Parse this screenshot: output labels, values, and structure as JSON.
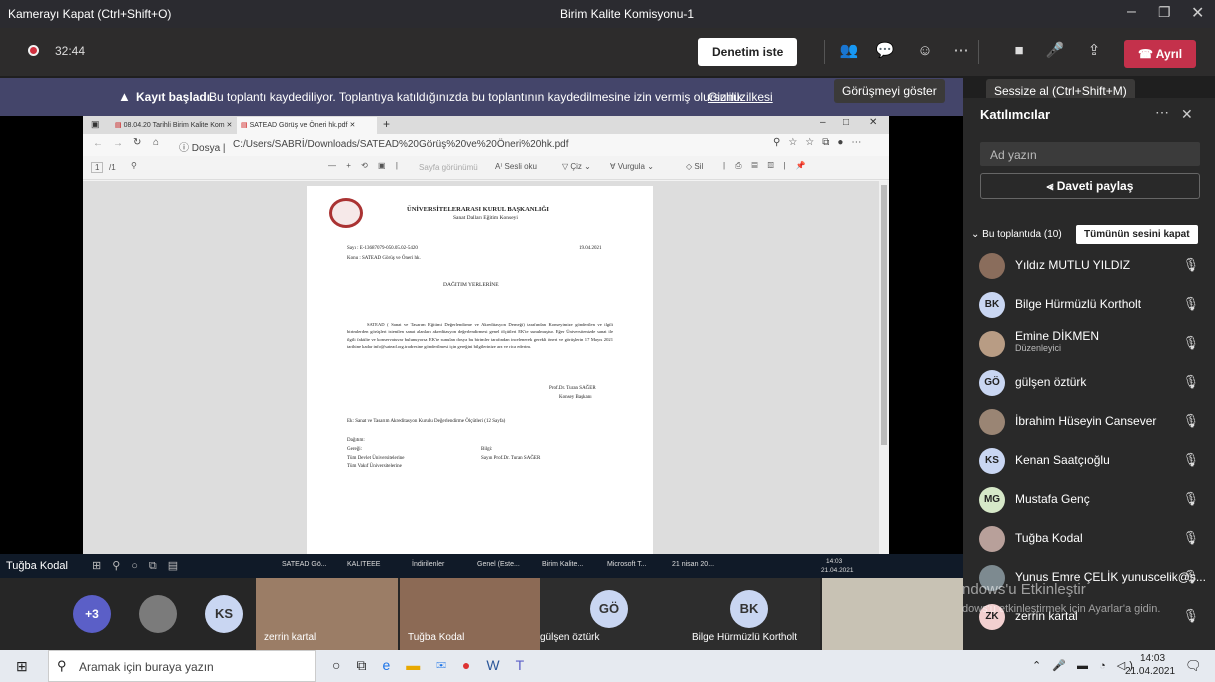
{
  "window": {
    "camera_toggle": "Kamerayı Kapat (Ctrl+Shift+O)",
    "title": "Birim Kalite Komisyonu-1"
  },
  "toolbar": {
    "timer": "32:44",
    "raise_label": "Denetim iste",
    "leave_label": "Ayrıl",
    "tooltip_chat": "Görüşmeyi göster",
    "tooltip_mute": "Sessize al (Ctrl+Shift+M)"
  },
  "banner": {
    "bold": "Kayıt başladı.",
    "text": "Bu toplantı kaydediliyor. Toplantıya katıldığınızda bu toplantının kaydedilmesine izin vermiş olursunuz.",
    "link": "Gizlilik ilkesi"
  },
  "browser": {
    "tab1": "08.04.20 Tarihli Birim Kalite Kom",
    "tab2": "SATEAD Görüş ve Öneri hk.pdf",
    "url_prefix": "Dosya",
    "url": "C:/Users/SABRİ/Downloads/SATEAD%20Görüş%20ve%20Öneri%20hk.pdf",
    "page": "1",
    "page_total": "/1",
    "tb_sayfa": "Sayfa görünümü",
    "tb_sesli": "Sesli oku",
    "tb_ciz": "Çiz",
    "tb_vurgula": "Vurgula",
    "tb_sil": "Sil"
  },
  "doc": {
    "org": "ÜNİVERSİTELERARASI KURUL BAŞKANLIĞI",
    "sub": "Sanat Dalları Eğitim Konseyi",
    "sayi": "Sayı    : E-13687079-050.05.02-5420",
    "date": "19.04.2021",
    "konu": "Konu    : SATEAD Görüş ve Öneri hk.",
    "heading": "DAĞITIM YERLERİNE",
    "body": "SATEAD ( Sanat ve Tasarım Eğitimi Değerlendirme ve Akreditasyon Derneği) tarafından Konseyimize gönderilen ve ilgili birimlerden görüşleri istenilen sanat alanları akreditasyon değerlendirmesi genel ölçütleri EK'te sunulmuştur. Eğer Üniversitenizde sanat ile ilgili fakülte ve konservatuvar bulunuyorsa EK'te sunulan dosya bu birimler tarafından incelenerek gerekli öneri ve görüşlerin 17 Mayıs 2021 tarihine kadar info@satead.org.tradresine gönderilmesi için gereğini bilgilerinize arz ve rica ederim.",
    "sign_name": "Prof.Dr. Turan SAĞER",
    "sign_title": "Konsey Başkanı",
    "ek": "Ek:   Sanat ve Tasarım Akreditasyon Kurulu Değerlendirme Ölçütleri (12 Sayfa)",
    "dagitim": "Dağıtım:",
    "geregi": "Gereği:",
    "bilgi": "Bilgi:",
    "d1": "Tüm Devlet Üniversitelerine",
    "d2": "Tüm Vakıf Üniversitelerine",
    "b1": "Sayın Prof.Dr. Turan SAĞER"
  },
  "shared_taskbar": {
    "presenter": "Tuğba Kodal",
    "apps": [
      "SATEAD Gö...",
      "KALITEEE",
      "İndirilenler",
      "Genel (Este...",
      "Birim Kalite...",
      "Microsoft T...",
      "21 nisan 20..."
    ],
    "time": "14:03",
    "date": "21.04.2021"
  },
  "panel": {
    "title": "Katılımcılar",
    "search_placeholder": "Ad yazın",
    "share": "Daveti paylaş",
    "section": "Bu toplantıda (10)",
    "mute_all": "Tümünün sesini kapat",
    "people": [
      {
        "name": "Yıldız MUTLU YILDIZ",
        "init": "",
        "color": "#8a6d5c",
        "role": ""
      },
      {
        "name": "Bilge Hürmüzlü Kortholt",
        "init": "BK",
        "color": "#c9d6f2",
        "role": ""
      },
      {
        "name": "Emine DİKMEN",
        "init": "",
        "color": "#b89c84",
        "role": "Düzenleyici"
      },
      {
        "name": "gülşen öztürk",
        "init": "GÖ",
        "color": "#c9d6f2",
        "role": ""
      },
      {
        "name": "İbrahim Hüseyin Cansever",
        "init": "",
        "color": "#9a8574",
        "role": ""
      },
      {
        "name": "Kenan Saatçıoğlu",
        "init": "KS",
        "color": "#c9d6f2",
        "role": ""
      },
      {
        "name": "Mustafa Genç",
        "init": "MG",
        "color": "#d6e8c8",
        "role": ""
      },
      {
        "name": "Tuğba Kodal",
        "init": "",
        "color": "#b8a09a",
        "role": ""
      },
      {
        "name": "Yunus Emre ÇELİK yunuscelik@s...",
        "init": "",
        "color": "#7d8a90",
        "role": ""
      },
      {
        "name": "zerrin kartal",
        "init": "ZK",
        "color": "#f2d0d0",
        "role": ""
      }
    ]
  },
  "gallery": {
    "more": "+3",
    "ks": "KS",
    "t1": "zerrin kartal",
    "t2": "Tuğba Kodal",
    "t3": "gülşen öztürk",
    "go": "GÖ",
    "t4": "Bilge Hürmüzlü Kortholt",
    "bk": "BK",
    "activate1": "ndows'u Etkinleştir",
    "activate2": "dows'u etkinleştirmek için Ayarlar'a gidin."
  },
  "taskbar": {
    "search": "Aramak için buraya yazın",
    "time": "14:03",
    "date": "21.04.2021"
  }
}
